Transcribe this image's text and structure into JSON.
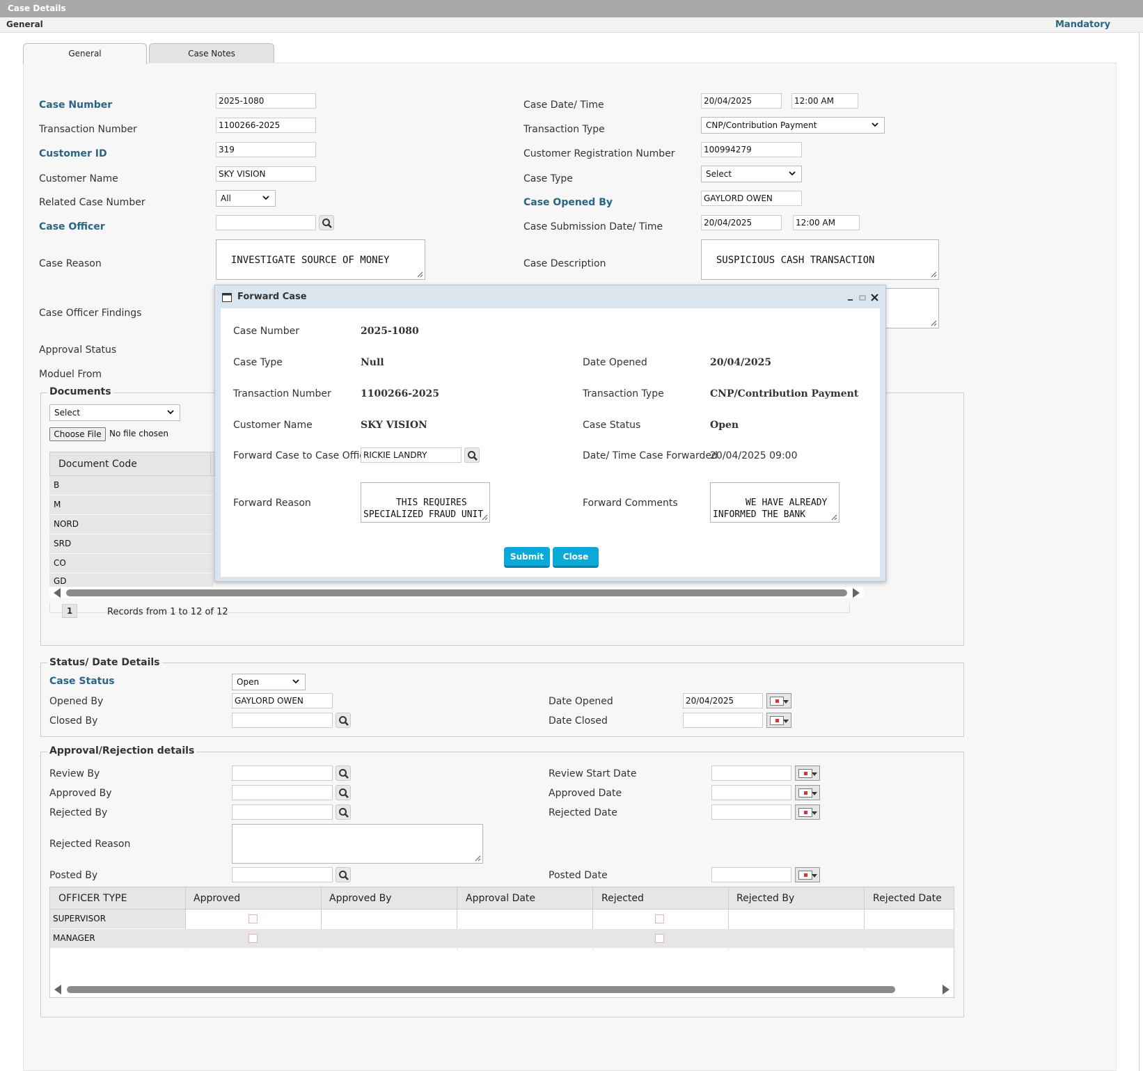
{
  "header": {
    "title": "Case Details",
    "section": "General",
    "mandatory": "Mandatory"
  },
  "tabs": [
    "General",
    "Case Notes"
  ],
  "form": {
    "case_number": {
      "label": "Case Number",
      "value": "2025-1080"
    },
    "transaction_number": {
      "label": "Transaction Number",
      "value": "1100266-2025"
    },
    "customer_id": {
      "label": "Customer ID",
      "value": "319"
    },
    "customer_name": {
      "label": "Customer Name",
      "value": "SKY VISION"
    },
    "related_case_number": {
      "label": "Related Case Number",
      "value": "All"
    },
    "case_officer": {
      "label": "Case Officer",
      "value": ""
    },
    "case_reason": {
      "label": "Case Reason",
      "value": "INVESTIGATE SOURCE OF MONEY"
    },
    "case_officer_findings": {
      "label": "Case Officer Findings"
    },
    "approval_status": {
      "label": "Approval Status"
    },
    "moduel_from": {
      "label": "Moduel From"
    },
    "case_date_time": {
      "label": "Case Date/ Time",
      "date": "20/04/2025",
      "time": "12:00 AM"
    },
    "transaction_type": {
      "label": "Transaction Type",
      "value": "CNP/Contribution Payment"
    },
    "customer_registration_number": {
      "label": "Customer Registration Number",
      "value": "100994279"
    },
    "case_type": {
      "label": "Case Type",
      "value": "Select"
    },
    "case_opened_by": {
      "label": "Case Opened By",
      "value": "GAYLORD OWEN"
    },
    "case_submission_date_time": {
      "label": "Case Submission Date/ Time",
      "date": "20/04/2025",
      "time": "12:00 AM"
    },
    "case_description": {
      "label": "Case Description",
      "value": "SUSPICIOUS CASH TRANSACTION"
    }
  },
  "documents": {
    "legend": "Documents",
    "select": "Select",
    "choose_file": "Choose File",
    "no_file": "No file chosen",
    "column": "Document Code",
    "rows": [
      "B",
      "M",
      "NORD",
      "SRD",
      "CO",
      "GD"
    ],
    "page": "1",
    "records": "Records from 1 to 12 of 12"
  },
  "status": {
    "legend": "Status/ Date Details",
    "case_status_label": "Case Status",
    "case_status_value": "Open",
    "opened_by_label": "Opened By",
    "opened_by_value": "GAYLORD OWEN",
    "closed_by_label": "Closed By",
    "date_opened_label": "Date Opened",
    "date_opened_value": "20/04/2025",
    "date_closed_label": "Date Closed"
  },
  "approval": {
    "legend": "Approval/Rejection details",
    "review_by": "Review By",
    "approved_by": "Approved By",
    "rejected_by": "Rejected By",
    "rejected_reason": "Rejected Reason",
    "posted_by": "Posted By",
    "review_start_date": "Review Start Date",
    "approved_date": "Approved Date",
    "rejected_date": "Rejected Date",
    "posted_date": "Posted Date",
    "columns": [
      "OFFICER TYPE",
      "Approved",
      "Approved By",
      "Approval Date",
      "Rejected",
      "Rejected By",
      "Rejected Date"
    ],
    "rows": [
      "SUPERVISOR",
      "MANAGER"
    ]
  },
  "modal": {
    "title": "Forward Case",
    "case_number_label": "Case Number",
    "case_number": "2025-1080",
    "case_type_label": "Case Type",
    "case_type": "Null",
    "date_opened_label": "Date Opened",
    "date_opened": "20/04/2025",
    "transaction_number_label": "Transaction Number",
    "transaction_number": "1100266-2025",
    "transaction_type_label": "Transaction Type",
    "transaction_type": "CNP/Contribution Payment",
    "customer_name_label": "Customer Name",
    "customer_name": "SKY VISION",
    "case_status_label": "Case Status",
    "case_status": "Open",
    "forward_officer_label": "Forward Case to Case Officer",
    "forward_officer": "RICKIE LANDRY",
    "forwarded_time_label": "Date/ Time Case Forwarded",
    "forwarded_time": "20/04/2025 09:00",
    "forward_reason_label": "Forward Reason",
    "forward_reason": "THIS REQUIRES\nSPECIALIZED FRAUD UNIT\nINTERVENTION",
    "forward_comments_label": "Forward Comments",
    "forward_comments": "WE HAVE ALREADY\nINFORMED THE BANK",
    "submit": "Submit",
    "close": "Close"
  },
  "colors": {
    "accent": "#2b6485",
    "button": "#0aa9d8",
    "titlebar": "#a9a9a9"
  },
  "icons": [
    "search-icon",
    "calendar-icon",
    "chevron-down-icon",
    "window-icon",
    "minimize-icon",
    "maximize-icon",
    "close-icon"
  ]
}
